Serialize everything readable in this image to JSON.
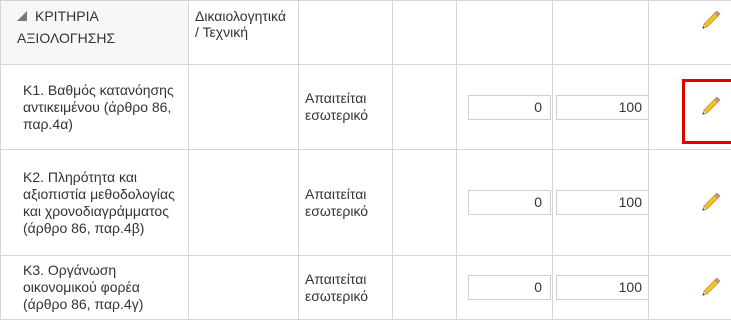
{
  "header": {
    "criteria_title": "ΚΡΙΤΗΡΙΑ ΑΞΙΟΛΟΓΗΣΗΣ",
    "documents_col": "Δικαιολογητικά / Τεχνική",
    "collapse_icon": "triangle-collapse-icon",
    "edit_icon": "pencil-icon"
  },
  "rows": [
    {
      "name": "Κ1. Βαθμός κατανόησης αντικειμένου (άρθρο 86, παρ.4α)",
      "requirement": "Απαιτείται εσωτερικό",
      "min": "0",
      "max": "100",
      "edit_icon": "pencil-icon"
    },
    {
      "name": "Κ2. Πληρότητα και αξιοπιστία μεθοδολογίας και χρονοδιαγράμματος (άρθρο 86, παρ.4β)",
      "requirement": "Απαιτείται εσωτερικό",
      "min": "0",
      "max": "100",
      "edit_icon": "pencil-icon"
    },
    {
      "name": "Κ3. Οργάνωση οικονομικού φορέα (άρθρο 86, παρ.4γ)",
      "requirement": "Απαιτείται εσωτερικό",
      "min": "0",
      "max": "100",
      "edit_icon": "pencil-icon"
    }
  ],
  "colors": {
    "highlight": "#e00000",
    "pencil_body": "#f2c230",
    "grid": "#d4d4d4"
  }
}
